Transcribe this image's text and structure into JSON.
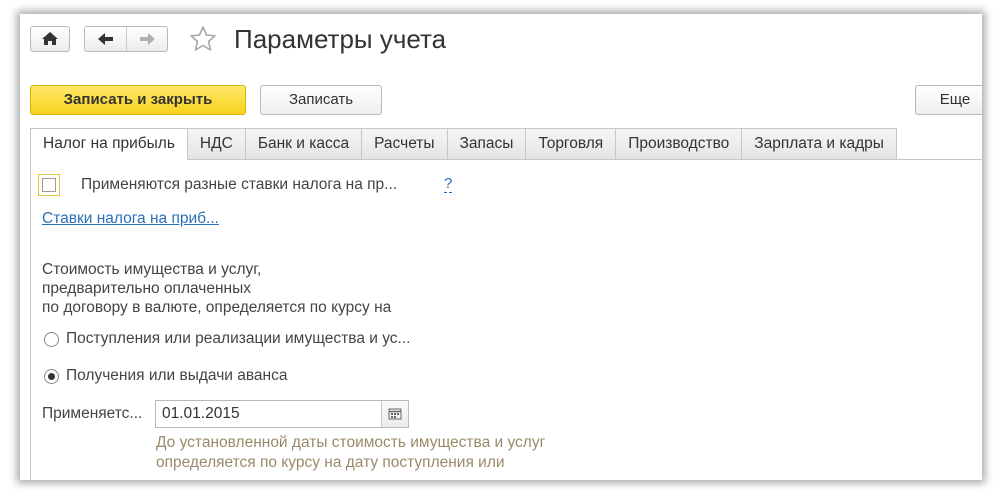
{
  "window": {
    "title": "Параметры учета"
  },
  "toolbar": {
    "save_close_label": "Записать и закрыть",
    "save_label": "Записать",
    "more_label": "Еще"
  },
  "tabs": [
    {
      "label": "Налог на прибыль",
      "active": true
    },
    {
      "label": "НДС",
      "active": false
    },
    {
      "label": "Банк и касса",
      "active": false
    },
    {
      "label": "Расчеты",
      "active": false
    },
    {
      "label": "Запасы",
      "active": false
    },
    {
      "label": "Торговля",
      "active": false
    },
    {
      "label": "Производство",
      "active": false
    },
    {
      "label": "Зарплата и кадры",
      "active": false
    }
  ],
  "profit_tax": {
    "different_rates_label": "Применяются разные ставки налога на пр...",
    "different_rates_checked": false,
    "help_mark": "?",
    "rates_link": "Ставки налога на приб..."
  },
  "currency_rate": {
    "description_lines": [
      "Стоимость имущества и услуг,",
      "предварительно оплаченных",
      "по договору в валюте, определяется по курсу на"
    ],
    "options": [
      {
        "label": "Поступления или реализации имущества и ус...",
        "checked": false
      },
      {
        "label": "Получения или выдачи аванса",
        "checked": true
      }
    ],
    "applies_label": "Применяетс...",
    "applies_date": "01.01.2015",
    "hint_lines": [
      "До установленной даты стоимость имущества и услуг",
      "определяется по курсу на дату поступления или"
    ]
  },
  "colors": {
    "primary_button": "#f7d21c",
    "link": "#2a6fb9",
    "hint_text": "#9a8a6a"
  },
  "icons": {
    "home": "home-icon",
    "back": "arrow-left-icon",
    "forward": "arrow-right-icon",
    "favorite": "star-icon",
    "calendar": "calendar-icon"
  }
}
